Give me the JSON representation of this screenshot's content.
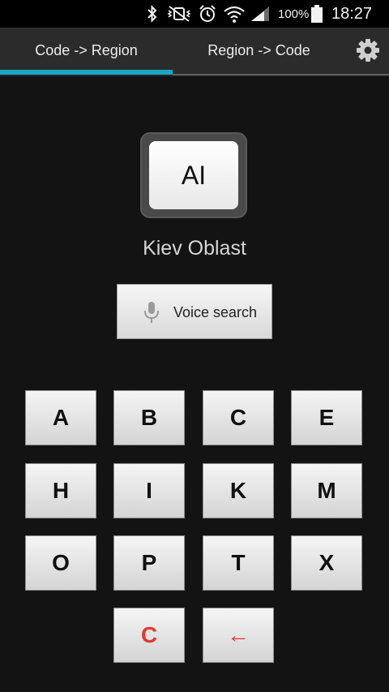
{
  "status_bar": {
    "battery": "100%",
    "time": "18:27"
  },
  "tabs": [
    {
      "label": "Code -> Region",
      "selected": true
    },
    {
      "label": "Region -> Code",
      "selected": false
    }
  ],
  "colors": {
    "accent": "#1ba6c2",
    "key_text_red": "#e53935",
    "background": "#131313"
  },
  "result": {
    "code": "AI",
    "region": "Kiev Oblast"
  },
  "voice_search": {
    "label": "Voice search"
  },
  "keypad": {
    "keys": [
      "A",
      "B",
      "C",
      "E",
      "H",
      "I",
      "K",
      "M",
      "O",
      "P",
      "T",
      "X"
    ],
    "clear": "C",
    "backspace": "←"
  }
}
